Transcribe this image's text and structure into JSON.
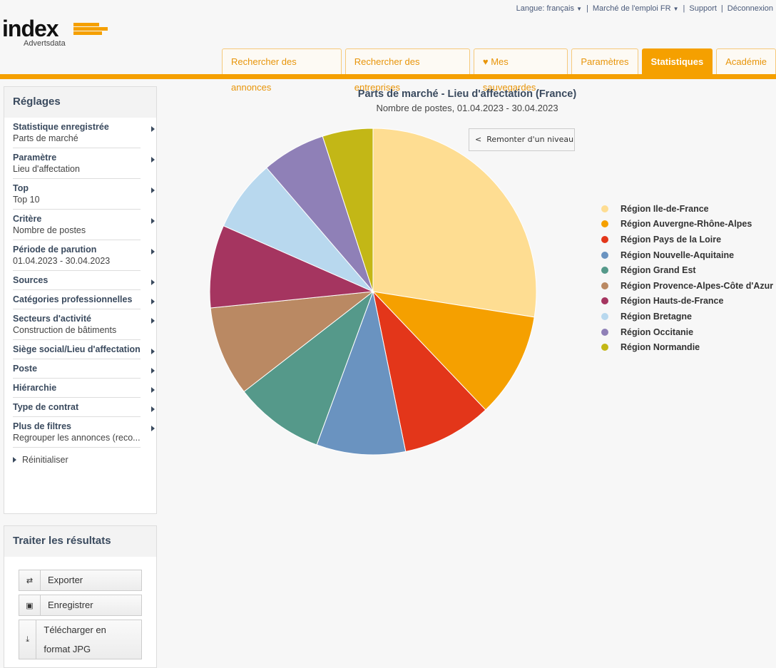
{
  "topnav": {
    "language": "Langue: français",
    "market": "Marché de l'emploi FR",
    "support": "Support",
    "logout": "Déconnexion"
  },
  "logo": {
    "word": "index",
    "sub": "Advertsdata"
  },
  "tabs": [
    {
      "label": "Rechercher des annonces"
    },
    {
      "label": "Rechercher des entreprises"
    },
    {
      "label": "Mes sauvegardes",
      "icon": "heart-icon"
    },
    {
      "label": "Paramètres"
    },
    {
      "label": "Statistiques",
      "active": true
    },
    {
      "label": "Académie"
    }
  ],
  "settings": {
    "title": "Réglages",
    "items": [
      {
        "t": "Statistique enregistrée",
        "v": "Parts de marché"
      },
      {
        "t": "Paramètre",
        "v": "Lieu d'affectation"
      },
      {
        "t": "Top",
        "v": "Top 10"
      },
      {
        "t": "Critère",
        "v": "Nombre de postes"
      },
      {
        "t": "Période de parution",
        "v": "01.04.2023 - 30.04.2023"
      },
      {
        "t": "Sources",
        "v": ""
      },
      {
        "t": "Catégories professionnelles",
        "v": ""
      },
      {
        "t": "Secteurs d'activité",
        "v": "Construction de bâtiments"
      },
      {
        "t": "Siège social/Lieu d'affectation",
        "v": ""
      },
      {
        "t": "Poste",
        "v": ""
      },
      {
        "t": "Hiérarchie",
        "v": ""
      },
      {
        "t": "Type de contrat",
        "v": ""
      },
      {
        "t": "Plus de filtres",
        "v": "Regrouper les annonces (reco..."
      }
    ],
    "reset": "Réinitialiser"
  },
  "results": {
    "title": "Traiter les résultats",
    "buttons": [
      {
        "label": "Exporter",
        "icon": "refresh-icon"
      },
      {
        "label": "Enregistrer",
        "icon": "save-icon"
      },
      {
        "label": "Télécharger en format JPG",
        "icon": "download-icon"
      }
    ]
  },
  "drill_up": "Remonter d'un niveau",
  "chart_data": {
    "type": "pie",
    "title": "Parts de marché - Lieu d'affectation (France)",
    "subtitle": "Nombre de postes, 01.04.2023 - 30.04.2023",
    "legend_position": "right",
    "unit": "percent (estimated)",
    "slices": [
      {
        "name": "Région Ile-de-France",
        "value": 27.5,
        "color": "#fedd92"
      },
      {
        "name": "Région Auvergne-Rhône-Alpes",
        "value": 10.4,
        "color": "#f5a000"
      },
      {
        "name": "Région Pays de la Loire",
        "value": 8.9,
        "color": "#e3361a"
      },
      {
        "name": "Région Nouvelle-Aquitaine",
        "value": 8.8,
        "color": "#6a93c0"
      },
      {
        "name": "Région Grand Est",
        "value": 8.9,
        "color": "#55998a"
      },
      {
        "name": "Région Provence-Alpes-Côte d'Azur",
        "value": 8.9,
        "color": "#ba8963"
      },
      {
        "name": "Région Hauts-de-France",
        "value": 8.2,
        "color": "#a53560"
      },
      {
        "name": "Région Bretagne",
        "value": 7.1,
        "color": "#b8d8ee"
      },
      {
        "name": "Région Occitanie",
        "value": 6.3,
        "color": "#8f80b7"
      },
      {
        "name": "Région Normandie",
        "value": 5.0,
        "color": "#c3b716"
      }
    ]
  }
}
